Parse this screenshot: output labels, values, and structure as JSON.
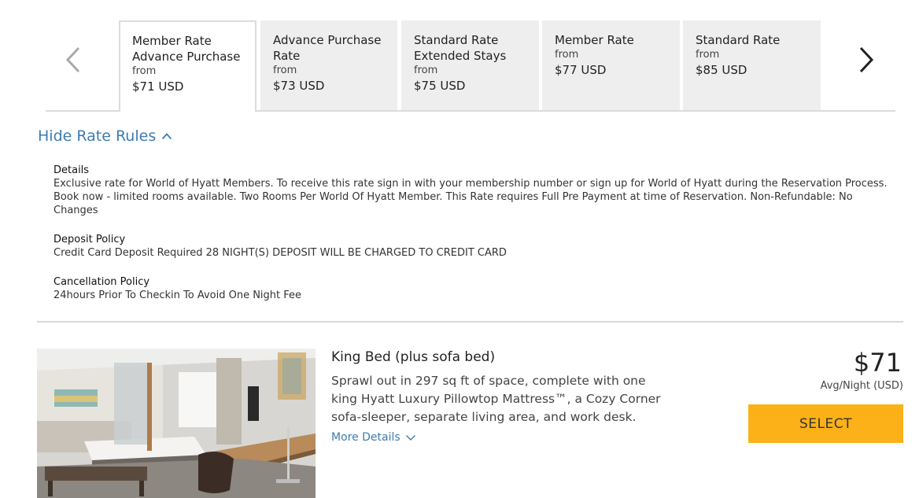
{
  "rate_tabs": [
    {
      "name": "Member Rate Advance Purchase",
      "from_label": "from",
      "price": "$71 USD",
      "active": true
    },
    {
      "name": "Advance Purchase Rate",
      "from_label": "from",
      "price": "$73 USD",
      "active": false
    },
    {
      "name": "Standard Rate Extended Stays",
      "from_label": "from",
      "price": "$75 USD",
      "active": false
    },
    {
      "name": "Member Rate",
      "from_label": "from",
      "price": "$77 USD",
      "active": false
    },
    {
      "name": "Standard Rate",
      "from_label": "from",
      "price": "$85 USD",
      "active": false
    }
  ],
  "nav": {
    "prev_icon": "chevron-left-icon",
    "next_icon": "chevron-right-icon"
  },
  "rules_toggle": {
    "label": "Hide Rate Rules",
    "icon": "chevron-up-icon"
  },
  "rules": {
    "details": {
      "heading": "Details",
      "text": "Exclusive rate for World of Hyatt Members. To receive this rate sign in with your membership number or sign up for World of Hyatt during the Reservation Process. Book now - limited rooms available. Two Rooms Per World Of Hyatt Member. This Rate requires Full Pre Payment at time of Reservation. Non-Refundable: No Changes"
    },
    "deposit": {
      "heading": "Deposit Policy",
      "text": "Credit Card Deposit Required 28 NIGHT(S) DEPOSIT WILL BE CHARGED TO CREDIT CARD"
    },
    "cancellation": {
      "heading": "Cancellation Policy",
      "text": "24hours Prior To Checkin To Avoid One Night Fee"
    }
  },
  "room": {
    "title": "King Bed (plus sofa bed)",
    "description": "Sprawl out in 297 sq ft of space, complete with one king Hyatt Luxury Pillowtop Mattress™, a Cozy Corner sofa-sleeper, separate living area, and work desk.",
    "more_details": "More Details",
    "price": "$71",
    "price_note": "Avg/Night (USD)",
    "select_label": "SELECT"
  },
  "colors": {
    "accent_link": "#3f7cb0",
    "select_button": "#fbb117",
    "tab_bg": "#eeeeee"
  }
}
